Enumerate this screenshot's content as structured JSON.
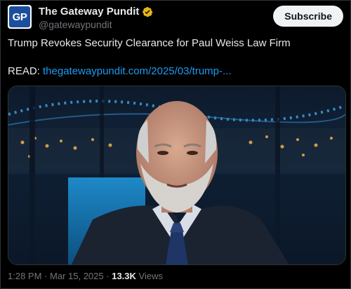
{
  "author": {
    "display_name": "The Gateway Pundit",
    "handle": "@gatewaypundit",
    "avatar_text": "GP"
  },
  "subscribe_label": "Subscribe",
  "post": {
    "text": "Trump Revokes Security Clearance for Paul Weiss Law Firm",
    "read_label": "READ: ",
    "link": "thegatewaypundit.com/2025/03/trump-..."
  },
  "meta": {
    "time": "1:28 PM",
    "separator": "·",
    "date": "Mar 15, 2025",
    "views_count": "13.3K",
    "views_label": "Views"
  },
  "icons": {
    "verified": "verified-badge-icon"
  },
  "colors": {
    "accent": "#1d9bf0",
    "verified_gold": "#e2b719",
    "background": "#000000"
  }
}
